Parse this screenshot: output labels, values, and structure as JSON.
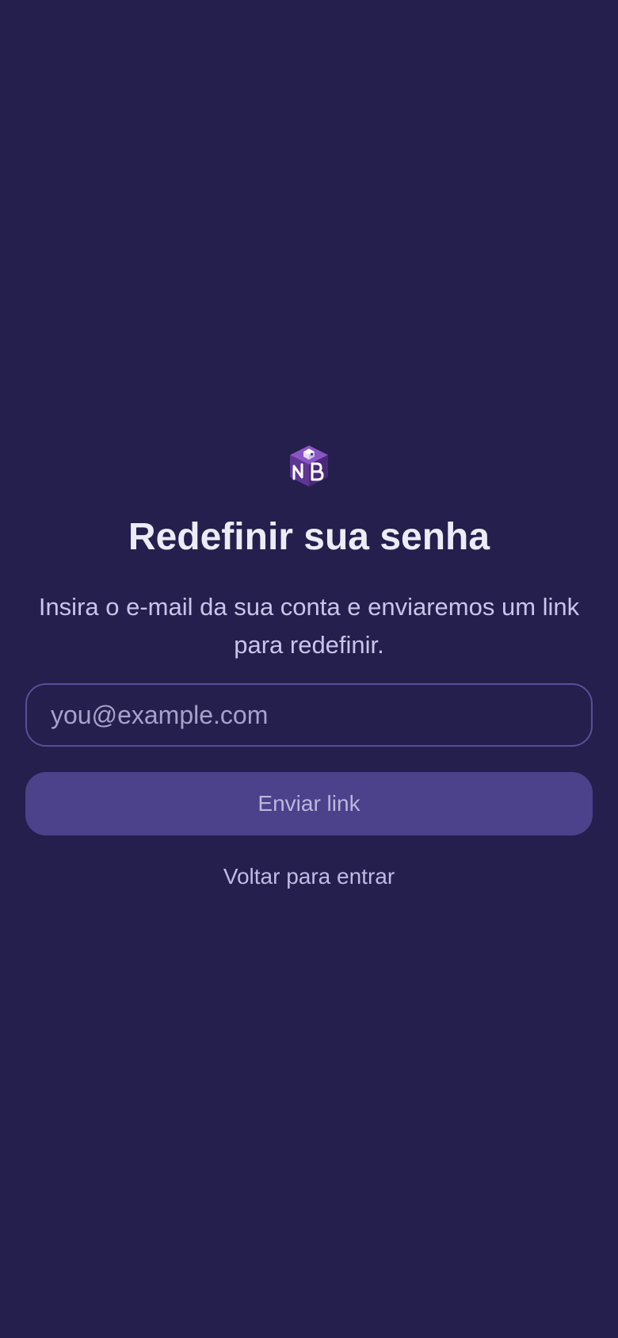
{
  "app": {
    "logo_icon": "nb-cube-logo",
    "logo_text": "NB"
  },
  "reset": {
    "title": "Redefinir sua senha",
    "subtitle": "Insira o e-mail da sua conta e enviaremos um link para redefinir.",
    "email_placeholder": "you@example.com",
    "email_value": "",
    "send_label": "Enviar link",
    "back_label": "Voltar para entrar"
  },
  "colors": {
    "background": "#241f4d",
    "title_text": "#ecebf7",
    "subtitle_text": "#c9c5ea",
    "input_border": "#5a4f98",
    "button_bg": "#4b428b",
    "button_text": "#bcb6de",
    "logo_purple": "#6b3fa0"
  }
}
